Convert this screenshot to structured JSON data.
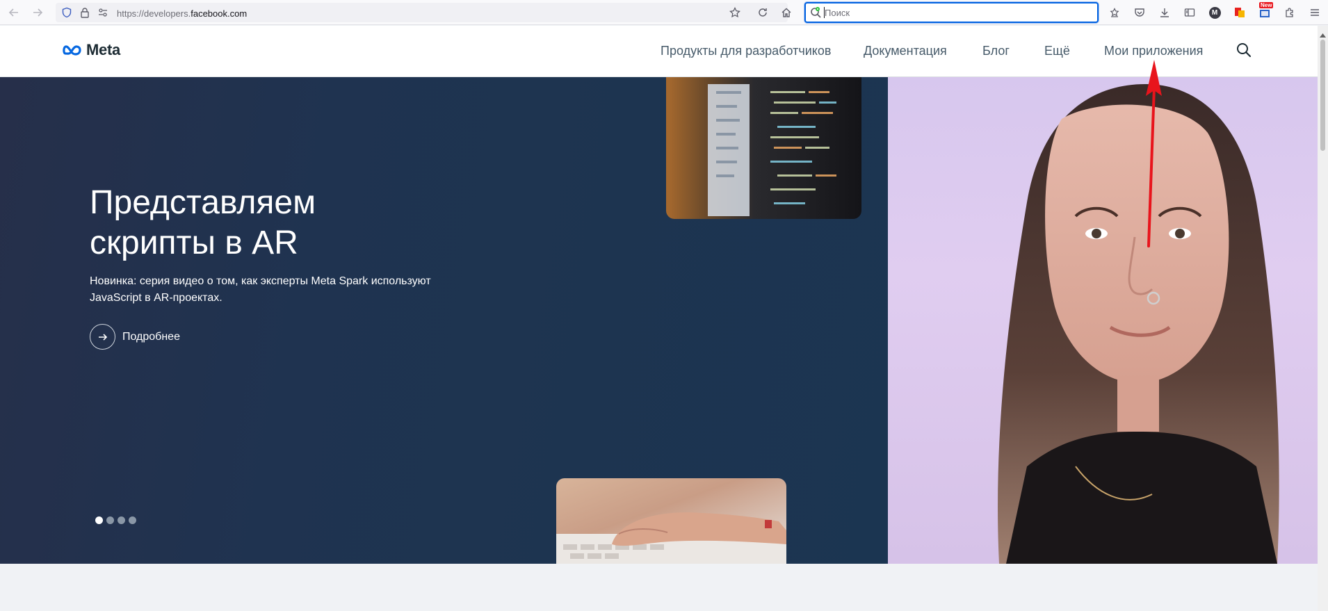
{
  "browser": {
    "url_prefix": "https://developers.",
    "url_domain": "facebook.com",
    "search_placeholder": "Поиск",
    "badge_new": "New",
    "profile_letter": "M"
  },
  "header": {
    "logo_text": "Meta",
    "nav": [
      {
        "label": "Продукты для разработчиков"
      },
      {
        "label": "Документация"
      },
      {
        "label": "Блог"
      },
      {
        "label": "Ещё"
      },
      {
        "label": "Мои приложения"
      }
    ]
  },
  "hero": {
    "title_line1": "Представляем",
    "title_line2": "скрипты в AR",
    "subtitle": "Новинка: серия видео о том, как эксперты Meta Spark используют JavaScript в AR-проектах.",
    "cta_label": "Подробнее",
    "slides_count": 4,
    "active_slide": 1
  },
  "colors": {
    "accent_blue": "#0061e0",
    "hero_bg": "#1f3350",
    "meta_blue": "#0668e1",
    "annotation_arrow": "#e8141c"
  }
}
